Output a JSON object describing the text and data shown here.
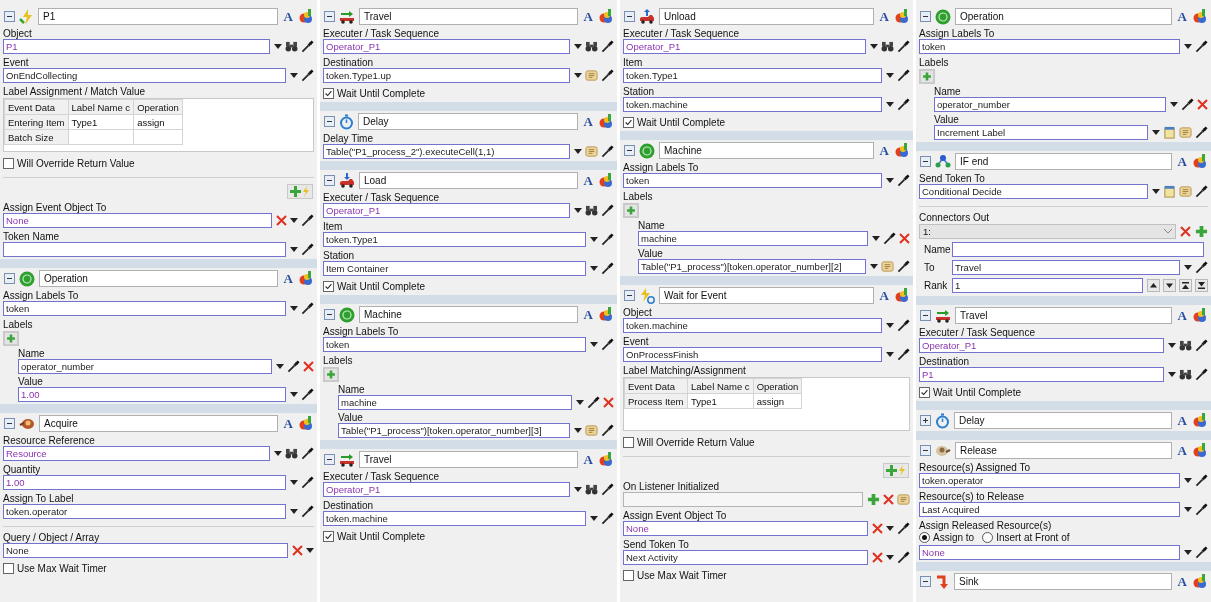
{
  "columns": [
    {
      "panels": [
        {
          "kind": "event",
          "title": "P1",
          "collapsed": false,
          "font_button": "A",
          "rows": [
            {
              "kind": "field",
              "label": "Object",
              "value": "P1",
              "reference": true,
              "disabled": false,
              "tools": [
                {
                  "kind": "dropdown"
                },
                {
                  "kind": "find"
                },
                {
                  "kind": "eyedropper"
                }
              ]
            },
            {
              "kind": "field",
              "label": "Event",
              "value": "OnEndCollecting",
              "reference": false,
              "disabled": false,
              "tools": [
                {
                  "kind": "dropdown"
                },
                {
                  "kind": "eyedropper"
                }
              ]
            },
            {
              "kind": "table",
              "label": "Label Assignment / Match Value",
              "columns": [
                "Event Data",
                "Label Name c",
                "Operation"
              ],
              "rows": [
                [
                  "Entering Item",
                  "Type1",
                  "assign"
                ],
                [
                  "Batch Size"
                ]
              ]
            },
            {
              "kind": "checkbox",
              "label": "Will Override Return Value",
              "checked": false
            },
            {
              "kind": "listener"
            },
            {
              "kind": "field",
              "label": "Assign Event Object To",
              "value": "None",
              "reference": true,
              "disabled": false,
              "tools": [
                {
                  "kind": "clear"
                },
                {
                  "kind": "dropdown"
                },
                {
                  "kind": "eyedropper"
                }
              ]
            },
            {
              "kind": "field",
              "label": "Token Name",
              "reference": false,
              "disabled": false,
              "tools": [
                {
                  "kind": "dropdown"
                },
                {
                  "kind": "eyedropper"
                }
              ]
            }
          ]
        },
        {
          "kind": "label",
          "title": "Operation",
          "collapsed": false,
          "font_button": "A",
          "rows": [
            {
              "kind": "field",
              "label": "Assign Labels To",
              "value": "token",
              "reference": false,
              "disabled": false,
              "tools": [
                {
                  "kind": "dropdown"
                },
                {
                  "kind": "eyedropper"
                }
              ]
            },
            {
              "kind": "labels",
              "label": "Labels",
              "entries": [
                {
                  "name_label": "Name",
                  "name": "operator_number",
                  "value_label": "Value",
                  "value": "1.00",
                  "reference": true,
                  "value_tools": [
                    {
                      "kind": "dropdown"
                    },
                    {
                      "kind": "eyedropper"
                    }
                  ]
                }
              ]
            }
          ]
        },
        {
          "kind": "acquire",
          "title": "Acquire",
          "collapsed": false,
          "font_button": "A",
          "rows": [
            {
              "kind": "field",
              "label": "Resource Reference",
              "value": "Resource",
              "reference": true,
              "disabled": false,
              "tools": [
                {
                  "kind": "dropdown"
                },
                {
                  "kind": "find"
                },
                {
                  "kind": "eyedropper"
                }
              ]
            },
            {
              "kind": "field",
              "label": "Quantity",
              "value": "1.00",
              "reference": true,
              "disabled": false,
              "tools": [
                {
                  "kind": "dropdown"
                },
                {
                  "kind": "eyedropper"
                }
              ]
            },
            {
              "kind": "field",
              "label": "Assign To Label",
              "value": "token.operator",
              "reference": false,
              "disabled": false,
              "tools": [
                {
                  "kind": "dropdown"
                },
                {
                  "kind": "eyedropper"
                }
              ]
            },
            {
              "kind": "divider"
            },
            {
              "kind": "field",
              "label": "Query / Object / Array",
              "value": "None",
              "reference": false,
              "disabled": false,
              "tools": [
                {
                  "kind": "clear"
                },
                {
                  "kind": "dropdown"
                }
              ]
            },
            {
              "kind": "checkbox",
              "label": "Use Max Wait Timer",
              "checked": false
            }
          ]
        }
      ]
    },
    {
      "panels": [
        {
          "kind": "travel",
          "title": "Travel",
          "collapsed": false,
          "font_button": "A",
          "rows": [
            {
              "kind": "field",
              "label": "Executer / Task Sequence",
              "value": "Operator_P1",
              "reference": true,
              "disabled": false,
              "tools": [
                {
                  "kind": "dropdown"
                },
                {
                  "kind": "find"
                },
                {
                  "kind": "eyedropper"
                }
              ]
            },
            {
              "kind": "field",
              "label": "Destination",
              "value": "token.Type1.up",
              "reference": false,
              "disabled": false,
              "tools": [
                {
                  "kind": "dropdown"
                },
                {
                  "kind": "script"
                },
                {
                  "kind": "eyedropper"
                }
              ]
            },
            {
              "kind": "checkbox",
              "label": "Wait Until Complete",
              "checked": true
            }
          ]
        },
        {
          "kind": "delay",
          "title": "Delay",
          "collapsed": false,
          "font_button": "A",
          "rows": [
            {
              "kind": "field",
              "label": "Delay Time",
              "value": "Table(\"P1_process_2\").executeCell(1,1)",
              "reference": false,
              "disabled": false,
              "tools": [
                {
                  "kind": "dropdown"
                },
                {
                  "kind": "script"
                },
                {
                  "kind": "eyedropper"
                }
              ]
            }
          ]
        },
        {
          "kind": "load",
          "title": "Load",
          "collapsed": false,
          "font_button": "A",
          "rows": [
            {
              "kind": "field",
              "label": "Executer / Task Sequence",
              "value": "Operator_P1",
              "reference": true,
              "disabled": false,
              "tools": [
                {
                  "kind": "dropdown"
                },
                {
                  "kind": "find"
                },
                {
                  "kind": "eyedropper"
                }
              ]
            },
            {
              "kind": "field",
              "label": "Item",
              "value": "token.Type1",
              "reference": false,
              "disabled": false,
              "tools": [
                {
                  "kind": "dropdown"
                },
                {
                  "kind": "eyedropper"
                }
              ]
            },
            {
              "kind": "field",
              "label": "Station",
              "value": "Item Container",
              "reference": false,
              "disabled": false,
              "tools": [
                {
                  "kind": "dropdown"
                },
                {
                  "kind": "eyedropper"
                }
              ]
            },
            {
              "kind": "checkbox",
              "label": "Wait Until Complete",
              "checked": true
            }
          ]
        },
        {
          "kind": "label",
          "title": "Machine",
          "collapsed": false,
          "font_button": "A",
          "rows": [
            {
              "kind": "field",
              "label": "Assign Labels To",
              "value": "token",
              "reference": false,
              "disabled": false,
              "tools": [
                {
                  "kind": "dropdown"
                },
                {
                  "kind": "eyedropper"
                }
              ]
            },
            {
              "kind": "labels",
              "label": "Labels",
              "entries": [
                {
                  "name_label": "Name",
                  "name": "machine",
                  "value_label": "Value",
                  "value": "Table(\"P1_process\")[token.operator_number][3]",
                  "reference": false,
                  "value_tools": [
                    {
                      "kind": "dropdown"
                    },
                    {
                      "kind": "script"
                    },
                    {
                      "kind": "eyedropper"
                    }
                  ]
                }
              ]
            }
          ]
        },
        {
          "kind": "travel",
          "title": "Travel",
          "collapsed": false,
          "font_button": "A",
          "rows": [
            {
              "kind": "field",
              "label": "Executer / Task Sequence",
              "value": "Operator_P1",
              "reference": true,
              "disabled": false,
              "tools": [
                {
                  "kind": "dropdown"
                },
                {
                  "kind": "find"
                },
                {
                  "kind": "eyedropper"
                }
              ]
            },
            {
              "kind": "field",
              "label": "Destination",
              "value": "token.machine",
              "reference": false,
              "disabled": false,
              "tools": [
                {
                  "kind": "dropdown"
                },
                {
                  "kind": "eyedropper"
                }
              ]
            },
            {
              "kind": "checkbox",
              "label": "Wait Until Complete",
              "checked": true
            }
          ]
        }
      ]
    },
    {
      "panels": [
        {
          "kind": "unload",
          "title": "Unload",
          "collapsed": false,
          "font_button": "A",
          "rows": [
            {
              "kind": "field",
              "label": "Executer / Task Sequence",
              "value": "Operator_P1",
              "reference": true,
              "disabled": false,
              "tools": [
                {
                  "kind": "dropdown"
                },
                {
                  "kind": "find"
                },
                {
                  "kind": "eyedropper"
                }
              ]
            },
            {
              "kind": "field",
              "label": "Item",
              "value": "token.Type1",
              "reference": false,
              "disabled": false,
              "tools": [
                {
                  "kind": "dropdown"
                },
                {
                  "kind": "eyedropper"
                }
              ]
            },
            {
              "kind": "field",
              "label": "Station",
              "value": "token.machine",
              "reference": false,
              "disabled": false,
              "tools": [
                {
                  "kind": "dropdown"
                },
                {
                  "kind": "eyedropper"
                }
              ]
            },
            {
              "kind": "checkbox",
              "label": "Wait Until Complete",
              "checked": true
            }
          ]
        },
        {
          "kind": "label",
          "title": "Machine",
          "collapsed": false,
          "font_button": "A",
          "rows": [
            {
              "kind": "field",
              "label": "Assign Labels To",
              "value": "token",
              "reference": false,
              "disabled": false,
              "tools": [
                {
                  "kind": "dropdown"
                },
                {
                  "kind": "eyedropper"
                }
              ]
            },
            {
              "kind": "labels",
              "label": "Labels",
              "entries": [
                {
                  "name_label": "Name",
                  "name": "machine",
                  "value_label": "Value",
                  "value": "Table(\"P1_process\")[token.operator_number][2]",
                  "reference": false,
                  "value_tools": [
                    {
                      "kind": "dropdown"
                    },
                    {
                      "kind": "script"
                    },
                    {
                      "kind": "eyedropper"
                    }
                  ]
                }
              ]
            }
          ]
        },
        {
          "kind": "wait",
          "title": "Wait for Event",
          "collapsed": false,
          "font_button": "A",
          "rows": [
            {
              "kind": "field",
              "label": "Object",
              "value": "token.machine",
              "reference": false,
              "disabled": false,
              "tools": [
                {
                  "kind": "dropdown"
                },
                {
                  "kind": "eyedropper"
                }
              ]
            },
            {
              "kind": "field",
              "label": "Event",
              "value": "OnProcessFinish",
              "reference": false,
              "disabled": false,
              "tools": [
                {
                  "kind": "dropdown"
                },
                {
                  "kind": "eyedropper"
                }
              ]
            },
            {
              "kind": "table",
              "label": "Label Matching/Assignment",
              "columns": [
                "Event Data",
                "Label Name c",
                "Operation"
              ],
              "rows": [
                [
                  "Process Item",
                  "Type1",
                  "assign"
                ]
              ]
            },
            {
              "kind": "checkbox",
              "label": "Will Override Return Value",
              "checked": false
            },
            {
              "kind": "listener"
            },
            {
              "kind": "field",
              "label": "On Listener Initialized",
              "reference": false,
              "disabled": true,
              "tools": [
                {
                  "kind": "add"
                },
                {
                  "kind": "clear"
                },
                {
                  "kind": "script"
                }
              ]
            },
            {
              "kind": "field",
              "label": "Assign Event Object To",
              "value": "None",
              "reference": true,
              "disabled": false,
              "tools": [
                {
                  "kind": "clear"
                },
                {
                  "kind": "dropdown"
                },
                {
                  "kind": "eyedropper"
                }
              ]
            },
            {
              "kind": "field",
              "label": "Send Token To",
              "value": "Next Activity",
              "reference": false,
              "disabled": false,
              "tools": [
                {
                  "kind": "clear"
                },
                {
                  "kind": "dropdown"
                },
                {
                  "kind": "eyedropper"
                }
              ]
            },
            {
              "kind": "checkbox",
              "label": "Use Max Wait Timer",
              "checked": false
            }
          ]
        }
      ]
    },
    {
      "panels": [
        {
          "kind": "label",
          "title": "Operation",
          "collapsed": false,
          "font_button": "A",
          "rows": [
            {
              "kind": "field",
              "label": "Assign Labels To",
              "value": "token",
              "reference": false,
              "disabled": false,
              "tools": [
                {
                  "kind": "dropdown"
                },
                {
                  "kind": "eyedropper"
                }
              ]
            },
            {
              "kind": "labels",
              "label": "Labels",
              "entries": [
                {
                  "name_label": "Name",
                  "name": "operator_number",
                  "value_label": "Value",
                  "value": "Increment Label",
                  "reference": false,
                  "value_tools": [
                    {
                      "kind": "dropdown"
                    },
                    {
                      "kind": "template"
                    },
                    {
                      "kind": "script"
                    },
                    {
                      "kind": "eyedropper"
                    }
                  ]
                }
              ]
            }
          ]
        },
        {
          "kind": "decide",
          "title": "IF end",
          "collapsed": false,
          "font_button": "A",
          "rows": [
            {
              "kind": "field",
              "label": "Send Token To",
              "value": "Conditional Decide",
              "reference": false,
              "disabled": false,
              "tools": [
                {
                  "kind": "dropdown"
                },
                {
                  "kind": "template"
                },
                {
                  "kind": "script"
                },
                {
                  "kind": "eyedropper"
                }
              ]
            },
            {
              "kind": "divider"
            },
            {
              "kind": "connectors",
              "label": "Connectors Out",
              "selector": "1:",
              "fields": [
                {
                  "label": "Name",
                  "reference": false
                },
                {
                  "label": "To",
                  "value": "Travel",
                  "reference": false,
                  "tools": [
                    {
                      "kind": "dropdown"
                    },
                    {
                      "kind": "eyedropper"
                    }
                  ]
                },
                {
                  "label": "Rank",
                  "value": "1",
                  "reference": false,
                  "tools": [
                    {
                      "kind": "up"
                    },
                    {
                      "kind": "down"
                    },
                    {
                      "kind": "top"
                    },
                    {
                      "kind": "bottom"
                    }
                  ]
                }
              ]
            }
          ]
        },
        {
          "kind": "travel",
          "title": "Travel",
          "collapsed": false,
          "font_button": "A",
          "rows": [
            {
              "kind": "field",
              "label": "Executer / Task Sequence",
              "value": "Operator_P1",
              "reference": true,
              "disabled": false,
              "tools": [
                {
                  "kind": "dropdown"
                },
                {
                  "kind": "find"
                },
                {
                  "kind": "eyedropper"
                }
              ]
            },
            {
              "kind": "field",
              "label": "Destination",
              "value": "P1",
              "reference": true,
              "disabled": false,
              "tools": [
                {
                  "kind": "dropdown"
                },
                {
                  "kind": "find"
                },
                {
                  "kind": "eyedropper"
                }
              ]
            },
            {
              "kind": "checkbox",
              "label": "Wait Until Complete",
              "checked": true
            }
          ]
        },
        {
          "kind": "delay",
          "title": "Delay",
          "collapsed": true,
          "font_button": "A"
        },
        {
          "kind": "release",
          "title": "Release",
          "collapsed": false,
          "font_button": "A",
          "rows": [
            {
              "kind": "field",
              "label": "Resource(s) Assigned To",
              "value": "token.operator",
              "reference": false,
              "disabled": false,
              "tools": [
                {
                  "kind": "dropdown"
                },
                {
                  "kind": "eyedropper"
                }
              ]
            },
            {
              "kind": "field",
              "label": "Resource(s) to Release",
              "value": "Last Acquired",
              "reference": false,
              "disabled": false,
              "tools": [
                {
                  "kind": "dropdown"
                },
                {
                  "kind": "eyedropper"
                }
              ]
            },
            {
              "kind": "radio",
              "label": "Assign Released Resource(s)",
              "options": [
                {
                  "label": "Assign to",
                  "selected": true
                },
                {
                  "label": "Insert at Front of",
                  "selected": false
                }
              ]
            },
            {
              "kind": "field",
              "value": "None",
              "reference": true,
              "disabled": false,
              "tools": [
                {
                  "kind": "dropdown"
                },
                {
                  "kind": "eyedropper"
                }
              ]
            }
          ]
        },
        {
          "kind": "sink",
          "title": "Sink",
          "collapsed": false,
          "font_button": "A"
        }
      ]
    }
  ]
}
